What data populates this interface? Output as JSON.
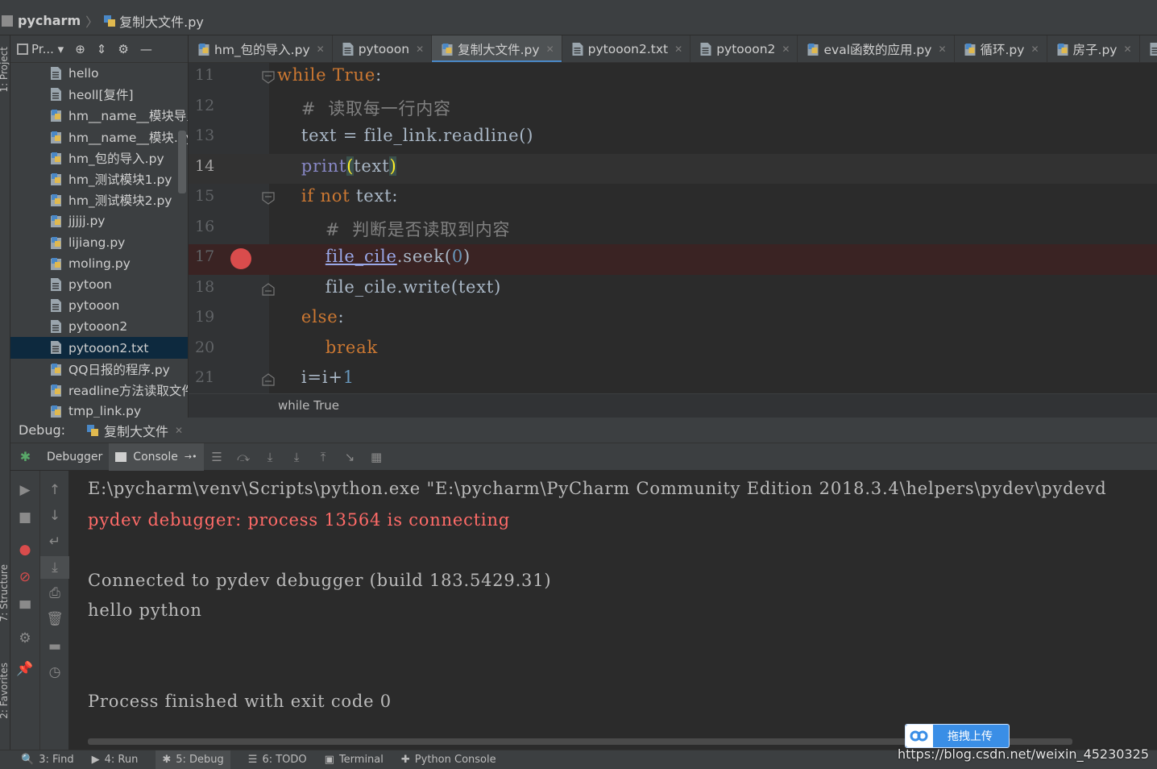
{
  "navbar": {
    "root": "pycharm",
    "file": "复制大文件.py"
  },
  "left_stripe": {
    "project_tab": "1: Project",
    "structure_tab": "7: Structure",
    "favorites_tab": "2: Favorites"
  },
  "project": {
    "title": "Pr...",
    "items": [
      {
        "label": "hello",
        "icon": "text-file-icon",
        "selected": false
      },
      {
        "label": "heoll[复件]",
        "icon": "text-file-icon",
        "selected": false
      },
      {
        "label": "hm__name__模块导入",
        "icon": "python-file-icon",
        "selected": false
      },
      {
        "label": "hm__name__模块.py",
        "icon": "python-file-icon",
        "selected": false
      },
      {
        "label": "hm_包的导入.py",
        "icon": "python-file-icon",
        "selected": false
      },
      {
        "label": "hm_测试模块1.py",
        "icon": "python-file-icon",
        "selected": false
      },
      {
        "label": "hm_测试模块2.py",
        "icon": "python-file-icon",
        "selected": false
      },
      {
        "label": "jjjjj.py",
        "icon": "python-file-icon",
        "selected": false
      },
      {
        "label": "lijiang.py",
        "icon": "python-file-icon",
        "selected": false
      },
      {
        "label": "moling.py",
        "icon": "python-file-icon",
        "selected": false
      },
      {
        "label": "pytoon",
        "icon": "text-file-icon",
        "selected": false
      },
      {
        "label": "pytooon",
        "icon": "text-file-icon",
        "selected": false
      },
      {
        "label": "pytooon2",
        "icon": "text-file-icon",
        "selected": false
      },
      {
        "label": "pytooon2.txt",
        "icon": "text-file-icon",
        "selected": true
      },
      {
        "label": "QQ日报的程序.py",
        "icon": "python-file-icon",
        "selected": false
      },
      {
        "label": "readline方法读取文件",
        "icon": "python-file-icon",
        "selected": false
      },
      {
        "label": "tmp_link.py",
        "icon": "python-file-icon",
        "selected": false
      }
    ]
  },
  "tabs": [
    {
      "label": "hm_包的导入.py",
      "icon": "python-file-icon",
      "active": false
    },
    {
      "label": "pytooon",
      "icon": "text-file-icon",
      "active": false
    },
    {
      "label": "复制大文件.py",
      "icon": "python-file-icon",
      "active": true
    },
    {
      "label": "pytooon2.txt",
      "icon": "text-file-icon",
      "active": false
    },
    {
      "label": "pytooon2",
      "icon": "text-file-icon",
      "active": false
    },
    {
      "label": "eval函数的应用.py",
      "icon": "python-file-icon",
      "active": false
    },
    {
      "label": "循环.py",
      "icon": "python-file-icon",
      "active": false
    },
    {
      "label": "房子.py",
      "icon": "python-file-icon",
      "active": false
    },
    {
      "label": "",
      "icon": "text-file-icon",
      "active": false
    }
  ],
  "editor": {
    "lines": [
      {
        "n": "11",
        "code": "while True:"
      },
      {
        "n": "12",
        "code": "    #  读取每一行内容"
      },
      {
        "n": "13",
        "code": "    text = file_link.readline()"
      },
      {
        "n": "14",
        "code": "    print(text)"
      },
      {
        "n": "15",
        "code": "    if not text:"
      },
      {
        "n": "16",
        "code": "        #  判断是否读取到内容"
      },
      {
        "n": "17",
        "code": "        file_cile.seek(0)"
      },
      {
        "n": "18",
        "code": "        file_cile.write(text)"
      },
      {
        "n": "19",
        "code": "    else:"
      },
      {
        "n": "20",
        "code": "        break"
      },
      {
        "n": "21",
        "code": "    i=i+1"
      }
    ],
    "current_line": "14",
    "breakpoint_line": "17",
    "breadcrumb": "while True"
  },
  "debug": {
    "title": "Debug:",
    "session": "复制大文件",
    "debugger_tab": "Debugger",
    "console_tab": "Console",
    "console_lines": [
      {
        "text": "E:\\pycharm\\venv\\Scripts\\python.exe \"E:\\pycharm\\PyCharm Community Edition 2018.3.4\\helpers\\pydev\\pydevd",
        "error": false
      },
      {
        "text": "pydev debugger: process 13564 is connecting",
        "error": true
      },
      {
        "text": "",
        "error": false
      },
      {
        "text": "Connected to pydev debugger (build 183.5429.31)",
        "error": false
      },
      {
        "text": "hello python",
        "error": false
      },
      {
        "text": "",
        "error": false
      },
      {
        "text": "",
        "error": false
      },
      {
        "text": "Process finished with exit code 0",
        "error": false
      }
    ]
  },
  "bottom_bar": {
    "find": "3: Find",
    "run": "4: Run",
    "debug": "5: Debug",
    "todo": "6: TODO",
    "terminal": "Terminal",
    "python_console": "Python Console"
  },
  "overlay": {
    "upload_label": "拖拽上传",
    "watermark": "https://blog.csdn.net/weixin_45230325"
  },
  "colors": {
    "keyword": "#cc7832",
    "comment": "#808080",
    "builtin": "#8888c6",
    "number": "#6897bb",
    "error_text": "#ff6b68",
    "selection": "#0d293e",
    "breakpoint": "#d94c4c"
  }
}
